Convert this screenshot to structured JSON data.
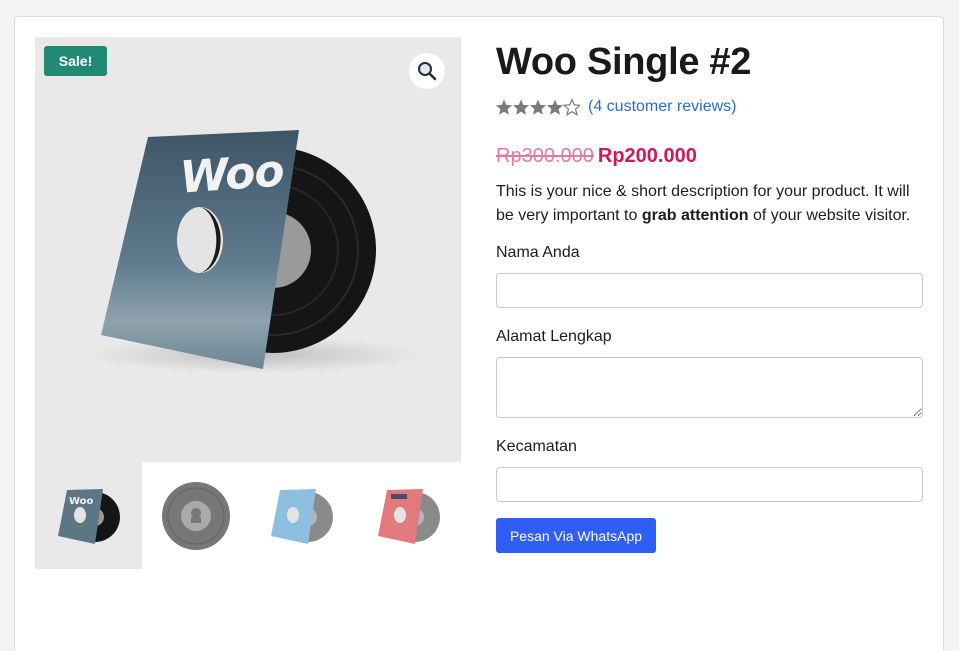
{
  "product": {
    "title": "Woo Single #2",
    "sale_badge": "Sale!",
    "rating": 4.5,
    "rating_max": 5,
    "reviews_link": "(4 customer reviews)",
    "old_price": "Rp300.000",
    "new_price": "Rp200.000",
    "description": {
      "part1": "This is your nice & short description for your product. It will be very important to ",
      "bold": "grab attention",
      "part2": " of your website visitor."
    },
    "cover_text": "Woo"
  },
  "form": {
    "name_label": "Nama Anda",
    "name_value": "",
    "address_label": "Alamat Lengkap",
    "address_value": "",
    "district_label": "Kecamatan",
    "district_value": "",
    "submit_label": "Pesan Via WhatsApp"
  },
  "icons": {
    "zoom": "magnifier-icon",
    "star": "star-icon"
  },
  "colors": {
    "sale_badge": "#228a74",
    "price_new": "#d6165a",
    "price_old": "#e17b9f",
    "link": "#2b6bd6",
    "button": "#2f5ef5",
    "stars": "#7b7b7b"
  }
}
